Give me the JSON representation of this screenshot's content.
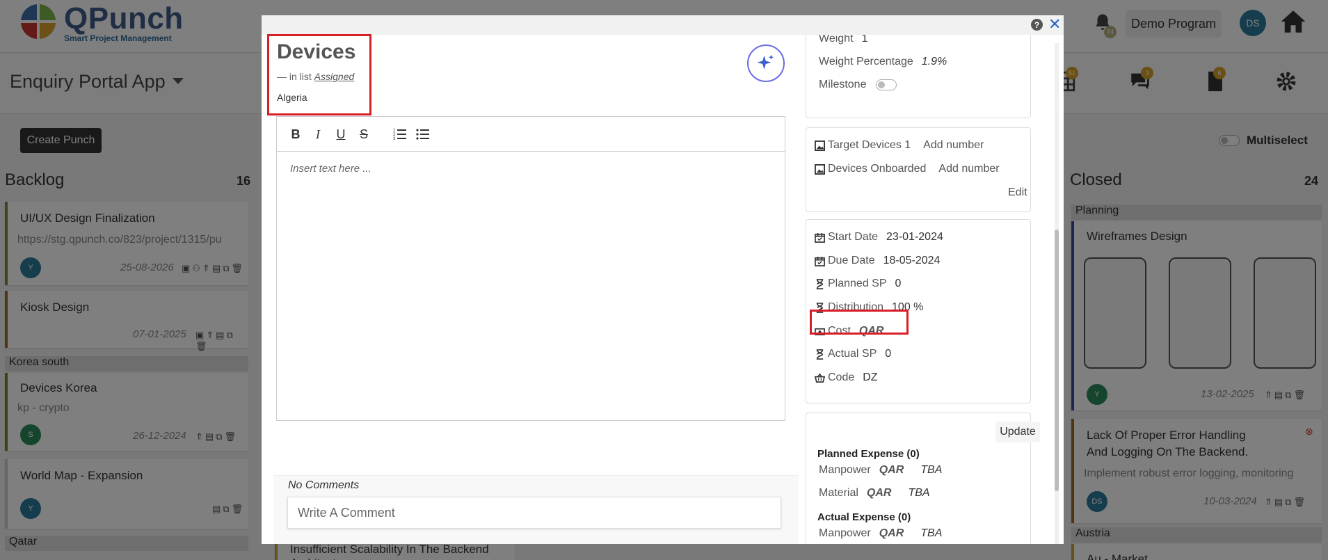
{
  "app": {
    "logo_text": "QPunch",
    "logo_tagline": "Smart Project Management",
    "program": "Demo Program",
    "user_initials": "DS",
    "notifications_count": "74",
    "project_title": "Enquiry Portal App",
    "sub_badges": [
      "51",
      "3",
      "6"
    ],
    "create_button": "Create Punch",
    "multiselect_label": "Multiselect"
  },
  "board": {
    "backlog": {
      "title": "Backlog",
      "count": "16",
      "cards": [
        {
          "title": "UI/UX Design Finalization",
          "sub": "https://stg.qpunch.co/823/project/1315/pu",
          "avatar": "Y",
          "date": "25-08-2026"
        },
        {
          "title": "Kiosk Design",
          "date": "07-01-2025"
        },
        {
          "group": "Korea south",
          "title": "Devices Korea",
          "sub": "kp - crypto",
          "avatar": "S",
          "date": "26-12-2024"
        },
        {
          "title": "World Map - Expansion",
          "avatar": "Y"
        },
        {
          "group": "Qatar",
          "title": "Insufficient Scalability In The Backend Architecture"
        }
      ]
    },
    "closed": {
      "title": "Closed",
      "count": "24",
      "cards": [
        {
          "group": "Planning",
          "title": "Wireframes Design",
          "avatar": "Y",
          "date": "13-02-2025"
        },
        {
          "title": "Lack Of Proper Error Handling And Logging On The Backend.",
          "sub": "Implement robust error logging, monitoring",
          "avatar": "DS",
          "date": "10-03-2024"
        },
        {
          "group": "Austria",
          "title": "Au - Market"
        }
      ]
    }
  },
  "modal": {
    "card_name": "Devices",
    "in_list_prefix": "— in list",
    "list_name": "Assigned",
    "country": "Algeria",
    "editor_placeholder": "Insert text here ...",
    "no_comments": "No Comments",
    "comment_placeholder": "Write A Comment",
    "help": "?",
    "close": "✕",
    "fields": {
      "weight_label": "Weight",
      "weight_value": "1",
      "weight_pct_label": "Weight Percentage",
      "weight_pct_value": "1.9%",
      "milestone_label": "Milestone",
      "target_devices_label": "Target Devices 1",
      "target_devices_value": "Add number",
      "devices_onboarded_label": "Devices Onboarded",
      "devices_onboarded_value": "Add number",
      "edit_label": "Edit",
      "start_date_label": "Start Date",
      "start_date_value": "23-01-2024",
      "due_date_label": "Due Date",
      "due_date_value": "18-05-2024",
      "planned_sp_label": "Planned SP",
      "planned_sp_value": "0",
      "distribution_label": "Distribution",
      "distribution_value": "100 %",
      "cost_label": "Cost",
      "cost_currency": "QAR",
      "actual_sp_label": "Actual SP",
      "actual_sp_value": "0",
      "code_label": "Code",
      "code_value": "DZ"
    },
    "expenses": {
      "update_label": "Update",
      "planned_title": "Planned Expense (0)",
      "actual_title": "Actual Expense (0)",
      "rows": [
        {
          "label": "Manpower",
          "currency": "QAR",
          "value": "TBA"
        },
        {
          "label": "Material",
          "currency": "QAR",
          "value": "TBA"
        }
      ],
      "actual_rows": [
        {
          "label": "Manpower",
          "currency": "QAR",
          "value": "TBA"
        }
      ]
    }
  }
}
